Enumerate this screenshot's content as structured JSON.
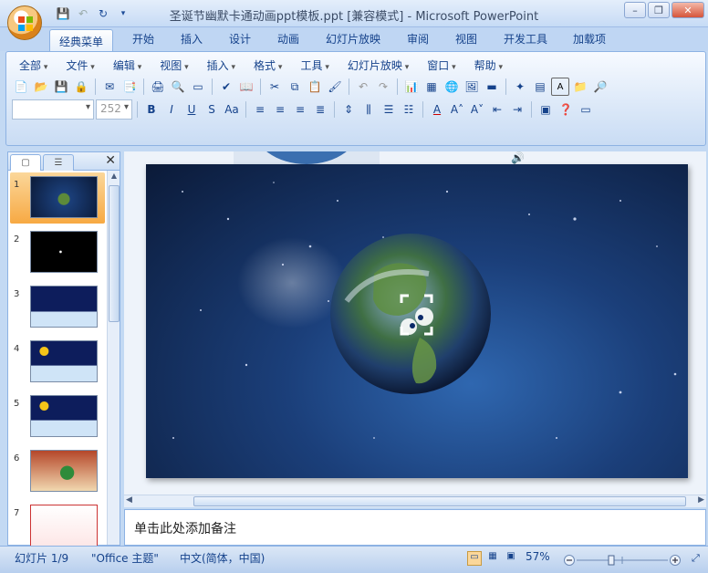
{
  "window": {
    "title": "圣诞节幽默卡通动画ppt模板.ppt [兼容模式] - Microsoft PowerPoint",
    "minimize_glyph": "–",
    "restore_glyph": "❐",
    "close_glyph": "✕"
  },
  "ribbon_tabs": [
    {
      "label": "经典菜单",
      "active": true
    },
    {
      "label": "开始"
    },
    {
      "label": "插入"
    },
    {
      "label": "设计"
    },
    {
      "label": "动画"
    },
    {
      "label": "幻灯片放映"
    },
    {
      "label": "审阅"
    },
    {
      "label": "视图"
    },
    {
      "label": "开发工具"
    },
    {
      "label": "加载项"
    }
  ],
  "classic_menu": [
    "全部",
    "文件",
    "编辑",
    "视图",
    "插入",
    "格式",
    "工具",
    "幻灯片放映",
    "窗口",
    "帮助"
  ],
  "font": {
    "name_value": "",
    "size_value": "252"
  },
  "slides_pane": {
    "tab_slides_icon": "slides-tab-icon",
    "tab_outline_icon": "outline-tab-icon",
    "close_glyph": "✕",
    "thumbnails": [
      {
        "num": "1",
        "selected": true,
        "theme": "earth"
      },
      {
        "num": "2",
        "theme": "dark"
      },
      {
        "num": "3",
        "theme": "snow-night"
      },
      {
        "num": "4",
        "theme": "moon-house"
      },
      {
        "num": "5",
        "theme": "moon-house"
      },
      {
        "num": "6",
        "theme": "window-tree"
      },
      {
        "num": "7",
        "theme": "card"
      }
    ]
  },
  "notes": {
    "placeholder": "单击此处添加备注"
  },
  "status": {
    "slide": "幻灯片 1/9",
    "theme": "\"Office 主题\"",
    "language": "中文(简体，中国)",
    "zoom": "57%",
    "zoom_fraction": 0.38
  }
}
